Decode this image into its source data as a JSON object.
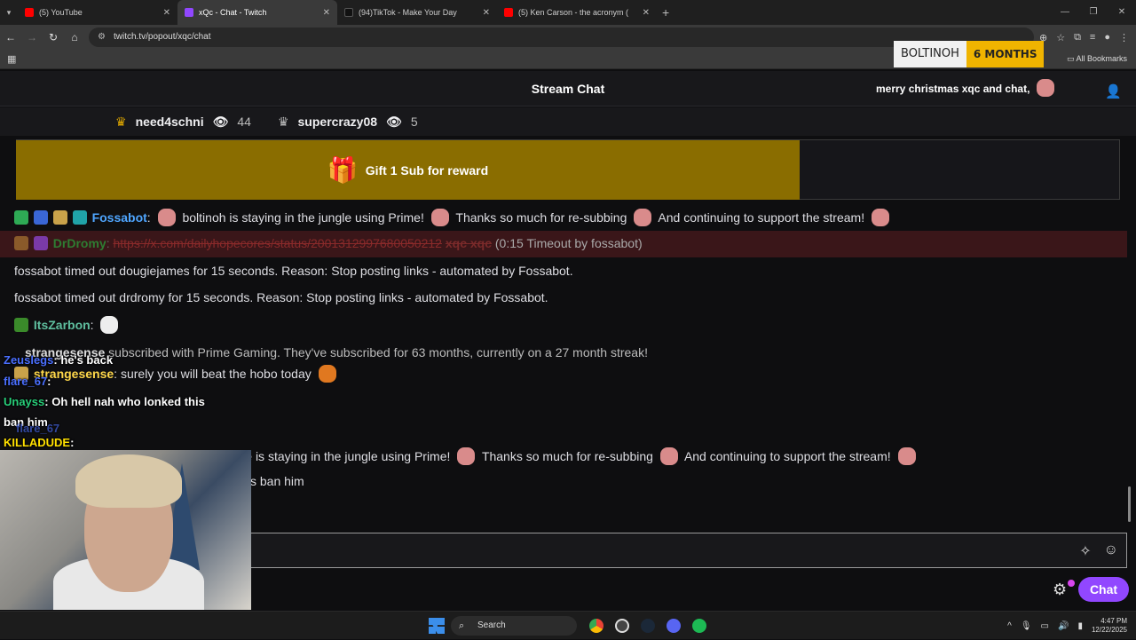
{
  "browser": {
    "tabs": [
      {
        "title": "(5) YouTube",
        "color": "#ff0000"
      },
      {
        "title": "xQc - Chat - Twitch",
        "color": "#9147ff"
      },
      {
        "title": "(94)TikTok - Make Your Day",
        "color": "#111111"
      },
      {
        "title": "(5) Ken Carson - the acronym (",
        "color": "#ff0000"
      }
    ],
    "url": "twitch.tv/popout/xqc/chat",
    "bookmarks_label": "All Bookmarks"
  },
  "sub_alert": {
    "user": "BOLTINOH",
    "months": "6 MONTHS"
  },
  "chat": {
    "title": "Stream Chat",
    "top_message": "merry christmas xqc and chat,",
    "leaderboard": [
      {
        "name": "need4schni",
        "count": "44"
      },
      {
        "name": "supercrazy08",
        "count": "5"
      }
    ],
    "gift_label": "Gift 1 Sub for reward",
    "messages": {
      "fossa_name": "Fossabot",
      "fossa_text_1": "boltinoh is staying in the jungle using Prime!",
      "fossa_text_2": "Thanks so much for re-subbing",
      "fossa_text_3": "And continuing to support the stream!",
      "drd_name": "DrDromy",
      "drd_link": "https://x.com/dailyhopecores/status/2001312997680050212",
      "drd_extra": "xqc xqc",
      "drd_timeout": "(0:15 Timeout by fossabot)",
      "timeout_1": "fossabot timed out dougiejames for 15 seconds. Reason: Stop posting links - automated by Fossabot.",
      "timeout_2": "fossabot timed out drdromy for 15 seconds. Reason: Stop posting links - automated by Fossabot.",
      "itz_name": "ItsZarbon",
      "sub_name": "strangesense",
      "sub_text": "subscribed with Prime Gaming. They've subscribed for 63 months, currently on a 27 month streak!",
      "strange_name": "strangesense",
      "strange_text": "surely you will beat the hobo today",
      "fossa2_text_1": "strangesense is staying in the jungle using Prime!",
      "fossa2_text_2": "Thanks so much for re-subbing",
      "fossa2_text_3": "And continuing to support the stream!",
      "ban_text": "s ban him"
    },
    "overlay": {
      "zeus_name": "Zeuslegs",
      "zeus_text": "he's back",
      "flare_name": "flare_67",
      "unayss_name": "Unayss",
      "unayss_text": "Oh hell nah who lonked this",
      "ban_text": "ban him",
      "flare2_name": "flare_67",
      "killa_name": "KILLADUDE"
    },
    "chat_button": "Chat"
  },
  "taskbar": {
    "search_label": "Search",
    "time": "4:47 PM",
    "date": "12/22/2025"
  }
}
